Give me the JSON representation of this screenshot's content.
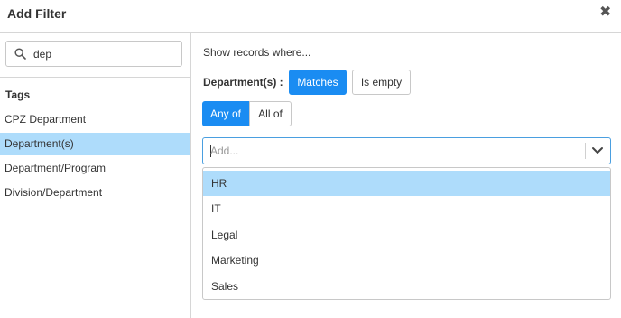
{
  "dialog": {
    "title": "Add Filter",
    "close_icon": "close-icon",
    "close_glyph": "✖"
  },
  "sidebar": {
    "search": {
      "value": "dep",
      "placeholder": ""
    },
    "tags_heading": "Tags",
    "items": [
      {
        "label": "CPZ Department",
        "selected": false
      },
      {
        "label": "Department(s)",
        "selected": true
      },
      {
        "label": "Department/Program",
        "selected": false
      },
      {
        "label": "Division/Department",
        "selected": false
      }
    ]
  },
  "main": {
    "prompt": "Show records where...",
    "field_label": "Department(s)  :",
    "match_buttons": {
      "matches": "Matches",
      "is_empty": "Is empty",
      "active": "Matches"
    },
    "mode_buttons": {
      "any_of": "Any of",
      "all_of": "All of",
      "active": "Any of"
    },
    "select": {
      "placeholder": "Add...",
      "value": ""
    },
    "options": [
      {
        "label": "HR",
        "highlighted": true
      },
      {
        "label": "IT",
        "highlighted": false
      },
      {
        "label": "Legal",
        "highlighted": false
      },
      {
        "label": "Marketing",
        "highlighted": false
      },
      {
        "label": "Sales",
        "highlighted": false
      }
    ]
  },
  "colors": {
    "accent": "#1a8cf2",
    "selection": "#aedcfb",
    "border": "#c8c8c8",
    "text": "#333333"
  }
}
